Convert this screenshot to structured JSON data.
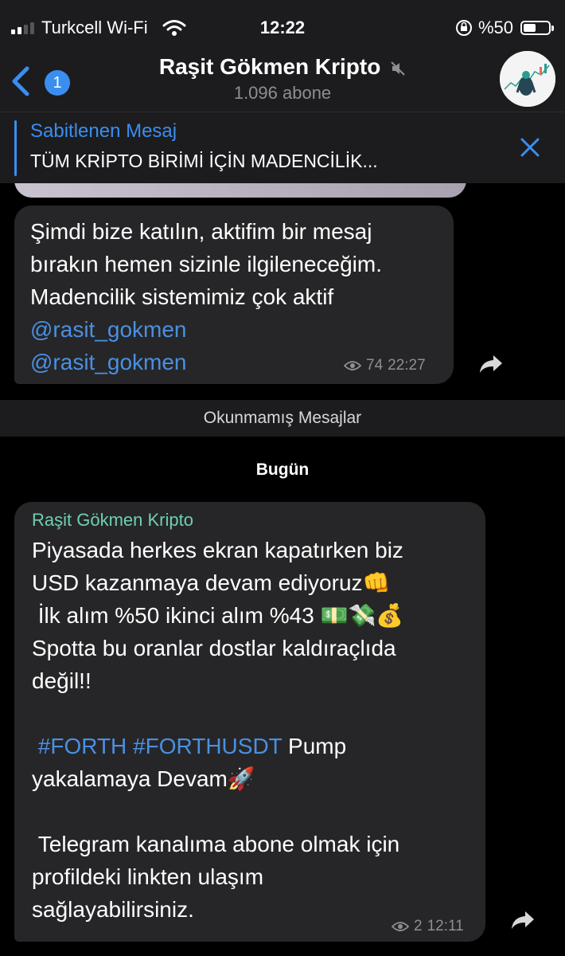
{
  "status_bar": {
    "carrier": "Turkcell Wi-Fi",
    "time": "12:22",
    "battery": "%50",
    "battery_level": 0.5
  },
  "header": {
    "back_badge": "1",
    "title": "Raşit Gökmen Kripto",
    "subtitle": "1.096 abone"
  },
  "pinned": {
    "title": "Sabitlenen Mesaj",
    "text": "TÜM KRİPTO BİRİMİ İÇİN MADENCİLİK..."
  },
  "messages": [
    {
      "lines": "Şimdi bize katılın, aktifim bir mesaj\nbırakın hemen sizinle ilgileneceğim.\nMadencilik sistemimiz çok aktif",
      "links": [
        "@rasit_gokmen",
        "@rasit_gokmen"
      ],
      "views": "74",
      "time": "22:27"
    },
    {
      "sender": "Raşit Gökmen Kripto",
      "line1": "Piyasada herkes ekran kapatırken biz",
      "line2": "USD kazanmaya devam ediyoruz",
      "line3": " İlk alım %50 ikinci alım %43 ",
      "line4": "Spotta bu oranlar dostlar kaldıraçlıda",
      "line5": "değil!!",
      "hashtag1": "#FORTH",
      "hashtag2": "#FORTHUSDT",
      "line6_rest": " Pump",
      "line7": "yakalamaya Devam",
      "line8": " Telegram kanalıma abone olmak için",
      "line9": "profildeki linkten ulaşım",
      "line10": "sağlayabilirsiniz.",
      "views": "2",
      "time": "12:11"
    }
  ],
  "unread_label": "Okunmamış Mesajlar",
  "date_label": "Bugün",
  "colors": {
    "accent": "#3a8ef0",
    "sender": "#6ecfb5",
    "bubble": "#262628"
  }
}
